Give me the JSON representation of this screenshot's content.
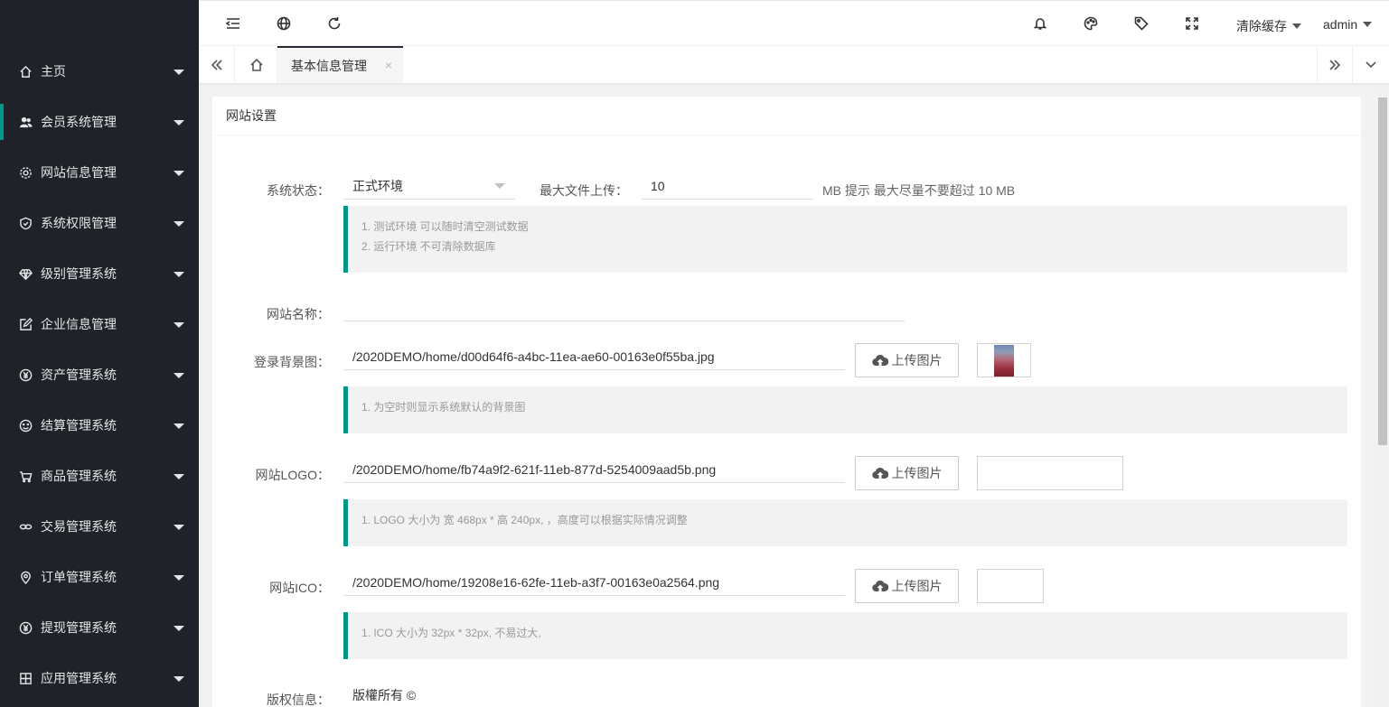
{
  "sidebar": {
    "items": [
      {
        "label": "主页",
        "icon": "home-icon"
      },
      {
        "label": "会员系统管理",
        "icon": "users-icon"
      },
      {
        "label": "网站信息管理",
        "icon": "gear-icon"
      },
      {
        "label": "系统权限管理",
        "icon": "shield-icon"
      },
      {
        "label": "级别管理系统",
        "icon": "diamond-icon"
      },
      {
        "label": "企业信息管理",
        "icon": "edit-icon"
      },
      {
        "label": "资产管理系统",
        "icon": "yen-icon"
      },
      {
        "label": "结算管理系统",
        "icon": "smile-icon"
      },
      {
        "label": "商品管理系统",
        "icon": "cart-icon"
      },
      {
        "label": "交易管理系统",
        "icon": "link-icon"
      },
      {
        "label": "订单管理系统",
        "icon": "location-icon"
      },
      {
        "label": "提现管理系统",
        "icon": "yen-icon"
      },
      {
        "label": "应用管理系统",
        "icon": "app-icon"
      }
    ]
  },
  "header": {
    "clear_cache": "清除缓存",
    "user": "admin"
  },
  "tabs": {
    "active_label": "基本信息管理",
    "close": "×"
  },
  "card": {
    "title": "网站设置",
    "status_label": "系统状态：",
    "status_value": "正式环境",
    "max_upload_label": "最大文件上传：",
    "max_upload_value": "10",
    "max_upload_hint": "MB 提示 最大尽量不要超过 10 MB",
    "status_tip_1": "1. 测试环境 可以随时清空测试数据",
    "status_tip_2": "2. 运行环境 不可清除数据库",
    "site_name_label": "网站名称：",
    "site_name_value": "",
    "bg_label": "登录背景图：",
    "bg_value": "/2020DEMO/home/d00d64f6-a4bc-11ea-ae60-00163e0f55ba.jpg",
    "bg_tip": "1. 为空时则显示系统默认的背景图",
    "logo_label": "网站LOGO：",
    "logo_value": "/2020DEMO/home/fb74a9f2-621f-11eb-877d-5254009aad5b.png",
    "logo_tip": "1. LOGO 大小为 宽 468px * 高 240px, ，高度可以根据实际情况调整",
    "ico_label": "网站ICO：",
    "ico_value": "/2020DEMO/home/19208e16-62fe-11eb-a3f7-00163e0a2564.png",
    "ico_tip": "1. ICO 大小为 32px * 32px, 不易过大,",
    "copyright_label": "版权信息：",
    "copyright_value": "版權所有 ©",
    "upload_label": "上传图片"
  },
  "colors": {
    "sidebar_bg": "#20222a",
    "accent": "#009688"
  }
}
